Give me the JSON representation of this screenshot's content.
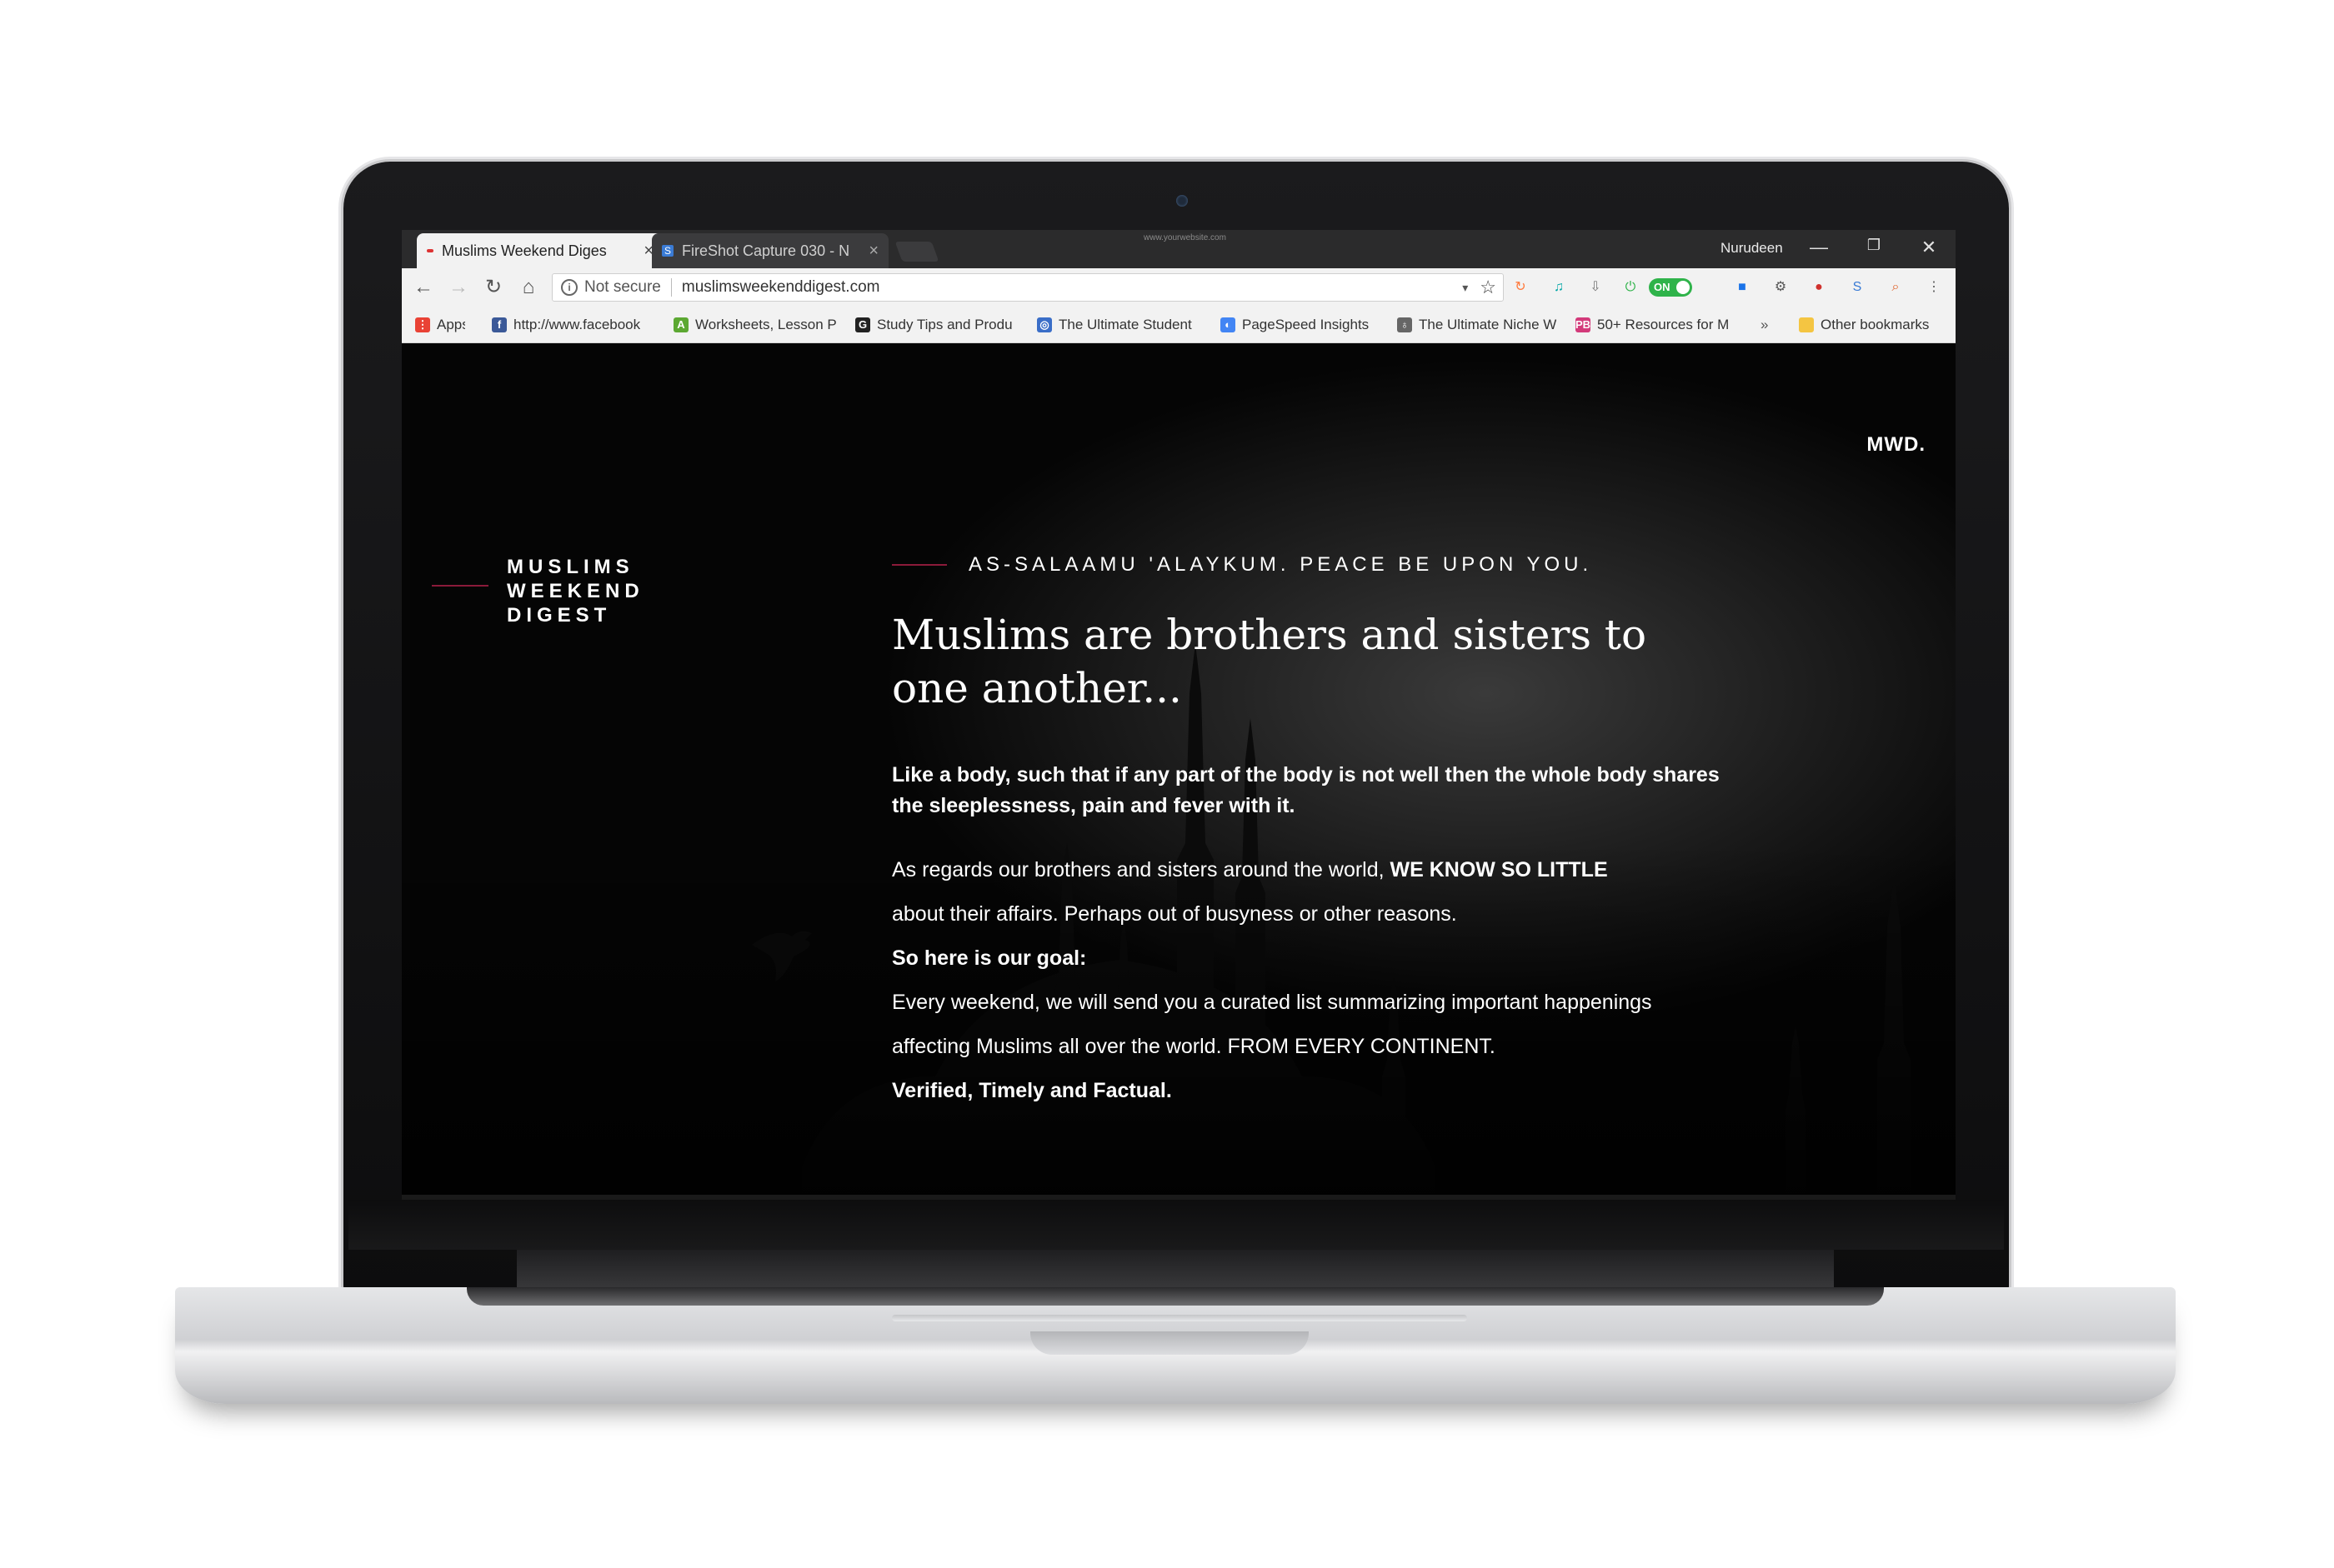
{
  "browser": {
    "tabs": [
      {
        "title": "Muslims Weekend Diges",
        "active": true,
        "favicon_color": "#d33"
      },
      {
        "title": "FireShot Capture 030 - N",
        "active": false,
        "favicon_color": "#3a7bd5"
      }
    ],
    "watermark": "www.yourwebsite.com",
    "profile_name": "Nurudeen",
    "window_controls": {
      "minimize": "—",
      "restore": "❐",
      "close": "✕"
    },
    "nav": {
      "back": "←",
      "forward": "→",
      "reload": "↻",
      "home": "⌂"
    },
    "address": {
      "security_label": "Not secure",
      "url": "muslimsweekenddigest.com"
    },
    "extensions": [
      {
        "name": "refresh-ext-icon",
        "color": "#ff7a3d",
        "glyph": "↻"
      },
      {
        "name": "headphones-ext-icon",
        "color": "#00a6a6",
        "glyph": "♫"
      },
      {
        "name": "download-ext-icon",
        "color": "#777777",
        "glyph": "⇩"
      },
      {
        "name": "power-ext-icon",
        "color": "#2fb34a",
        "glyph": "⏻"
      },
      {
        "name": "square-ext-icon",
        "color": "#1a73e8",
        "glyph": "■"
      },
      {
        "name": "gear-ext-icon",
        "color": "#555555",
        "glyph": "⚙"
      },
      {
        "name": "record-ext-icon",
        "color": "#d0312d",
        "glyph": "●"
      },
      {
        "name": "s-ext-icon",
        "color": "#3a7bd5",
        "glyph": "S"
      },
      {
        "name": "search-ext-icon",
        "color": "#e0622a",
        "glyph": "⌕"
      },
      {
        "name": "menu-ext-icon",
        "color": "#555555",
        "glyph": "⋮"
      }
    ],
    "toggle_label": "ON",
    "bookmarks": [
      {
        "label": "Apps",
        "color": "#e94235",
        "glyph": "⋮"
      },
      {
        "label": "http://www.facebook",
        "color": "#3b5998",
        "glyph": "f"
      },
      {
        "label": "Worksheets, Lesson P",
        "color": "#5ca832",
        "glyph": "A"
      },
      {
        "label": "Study Tips and Produ",
        "color": "#222222",
        "glyph": "G"
      },
      {
        "label": "The Ultimate Student",
        "color": "#3a6ec8",
        "glyph": "◎"
      },
      {
        "label": "PageSpeed Insights",
        "color": "#4285f4",
        "glyph": "◐"
      },
      {
        "label": "The Ultimate Niche W",
        "color": "#666666",
        "glyph": "♁"
      },
      {
        "label": "50+ Resources for M",
        "color": "#d33a7a",
        "glyph": "PB"
      }
    ],
    "bookmarks_overflow": "»",
    "other_bookmarks": "Other bookmarks"
  },
  "site": {
    "logo_short": "MWD.",
    "brand_lines": [
      "MUSLIMS",
      "WEEKEND",
      "DIGEST"
    ],
    "greeting": "AS-SALAAMU 'ALAYKUM. PEACE BE UPON YOU.",
    "headline": "Muslims are brothers and sisters to one another...",
    "lead": "Like a body, such that if any part of the body is not well then the whole body shares the sleeplessness, pain and fever with it.",
    "para1_a": "As regards our brothers and sisters around the world, ",
    "para1_b": "WE KNOW SO LITTLE",
    "para1_c": "about their affairs. Perhaps out of busyness or other reasons.",
    "goal_heading": "So here is our goal:",
    "goal_text": "Every weekend, we will send you a curated list summarizing important happenings affecting Muslims all over the world. FROM EVERY CONTINENT.",
    "closing": "Verified, Timely and Factual."
  },
  "colors": {
    "accent": "#8b1a3a",
    "site_bg": "#000000",
    "text": "#ffffff"
  }
}
